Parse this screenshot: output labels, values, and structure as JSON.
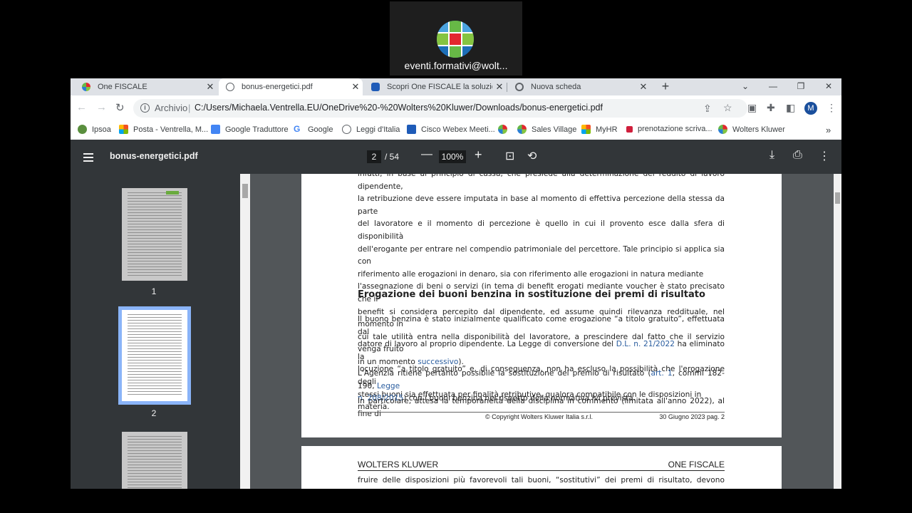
{
  "participant": {
    "name": "eventi.formativi@wolt..."
  },
  "tabs": [
    {
      "label": "One FISCALE",
      "active": false,
      "icon": "wk-logo-icon"
    },
    {
      "label": "bonus-energetici.pdf",
      "active": true,
      "icon": "globe-icon"
    },
    {
      "label": "Scopri One FISCALE la soluzione",
      "active": false,
      "icon": "webex-icon"
    },
    {
      "label": "Nuova scheda",
      "active": false,
      "icon": "chrome-icon"
    }
  ],
  "toolbar": {
    "scheme": "Archivio",
    "url": "C:/Users/Michaela.Ventrella.EU/OneDrive%20-%20Wolters%20Kluwer/Downloads/bonus-energetici.pdf",
    "avatar": "M"
  },
  "bookmarks": [
    "Ipsoa",
    "Posta - Ventrella, M...",
    "Google Traduttore",
    "Google",
    "Leggi d'Italia",
    "Cisco Webex Meeti...",
    "",
    "Sales Village",
    "MyHR",
    "prenotazione scriva...",
    "Wolters Kluwer"
  ],
  "bookmarks_more": "»",
  "pdf": {
    "filename": "bonus-energetici.pdf",
    "page": "2",
    "total": "/ 54",
    "zoom": "100%"
  },
  "thumbnails": [
    "1",
    "2"
  ],
  "doc": {
    "p1_lines": [
      "infatti, in base al principio di cassa, che presiede alla determinazione del reddito di lavoro dipendente,",
      "la retribuzione deve essere imputata in base al momento di effettiva percezione della stessa da parte",
      "del lavoratore e il momento di percezione è quello in cui il provento esce dalla sfera di disponibilità",
      "dell'erogante per entrare nel compendio patrimoniale del percettore. Tale principio si applica sia con",
      "riferimento alle erogazioni in denaro, sia con riferimento alle erogazioni in natura mediante",
      "l'assegnazione di beni o servizi (in tema di benefit erogati mediante voucher è stato precisato che il",
      "benefit si considera percepito dal dipendente, ed assume quindi rilevanza reddituale, nel momento in",
      "cui tale utilità entra nella disponibilità del lavoratore, a prescindere dal fatto che il servizio venga fruito"
    ],
    "p1_last_pre": "in un momento ",
    "p1_last_link": "successivo",
    "p1_last_post": ").",
    "heading": "Erogazione dei buoni benzina in sostituzione dei premi di risultato",
    "p2_l1": "Il buono benzina è stato inizialmente qualificato come erogazione “a titolo gratuito”, effettuata dal",
    "p2_l2_pre": "datore di lavoro al proprio dipendente. La Legge di conversione del ",
    "p2_l2_link": "D.L. n. 21/2022",
    "p2_l2_post": " ha eliminato la",
    "p2_l3": "locuzione “a titolo gratuito” e, di conseguenza, non ha escluso la possibilità che l'erogazione degli",
    "p2_l4": "stessi buoni sia effettuata per finalità retributive, qualora compatibile con le disposizioni in materia.",
    "p3_l1_pre": "L'Agenzia ritiene pertanto possibile la sostituzione del premio di risultato (",
    "p3_l1_link1": "art. 1",
    "p3_l1_mid": ", commi 182-190, ",
    "p3_l1_link2": "Legge",
    "p3_l2_link": "n. 208/2015",
    "p3_l2_post": ") con i buoni benzina nel rispetto della normativa ivi prevista.",
    "p4_l1": "In particolare, attesa la temporaneità della disciplina in commento (limitata all'anno 2022), al fine di",
    "footer_copy": "© Copyright Wolters Kluwer Italia s.r.l.",
    "footer_date": "30 Giugno 2023 pag. 2",
    "p3_header_left": "WOLTERS KLUWER",
    "p3_header_right": "ONE FISCALE",
    "p3_text": "fruire delle disposizioni più favorevoli tali buoni, “sostitutivi” dei premi di risultato, devono essere"
  }
}
